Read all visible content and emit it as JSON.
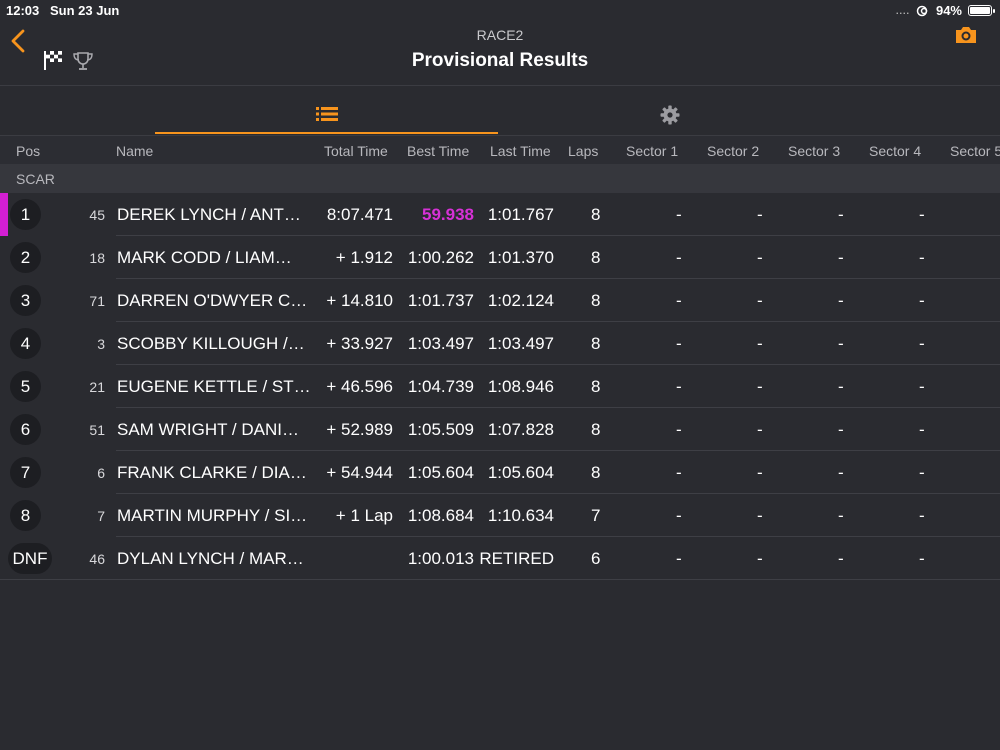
{
  "status_bar": {
    "time": "12:03",
    "date": "Sun 23 Jun",
    "signal": "....",
    "battery": "94%"
  },
  "header": {
    "subtitle": "RACE2",
    "title": "Provisional Results"
  },
  "colors": {
    "accent": "#f7941d",
    "fastest_lap": "#d631d6"
  },
  "columns": {
    "pos": "Pos",
    "name": "Name",
    "total_time": "Total Time",
    "best_time": "Best Time",
    "last_time": "Last Time",
    "laps": "Laps",
    "sector1": "Sector 1",
    "sector2": "Sector 2",
    "sector3": "Sector 3",
    "sector4": "Sector 4",
    "sector5": "Sector 5"
  },
  "class_label": "SCAR",
  "results": [
    {
      "pos": "1",
      "number": "45",
      "name": "DEREK LYNCH / ANT…",
      "total": "8:07.471",
      "best": "59.938",
      "last": "1:01.767",
      "laps": "8",
      "s1": "-",
      "s2": "-",
      "s3": "-",
      "s4": "-"
    },
    {
      "pos": "2",
      "number": "18",
      "name": "MARK CODD / LIAM…",
      "total": "+ 1.912",
      "best": "1:00.262",
      "last": "1:01.370",
      "laps": "8",
      "s1": "-",
      "s2": "-",
      "s3": "-",
      "s4": "-"
    },
    {
      "pos": "3",
      "number": "71",
      "name": "DARREN O'DWYER C…",
      "total": "+ 14.810",
      "best": "1:01.737",
      "last": "1:02.124",
      "laps": "8",
      "s1": "-",
      "s2": "-",
      "s3": "-",
      "s4": "-"
    },
    {
      "pos": "4",
      "number": "3",
      "name": "SCOBBY KILLOUGH /…",
      "total": "+ 33.927",
      "best": "1:03.497",
      "last": "1:03.497",
      "laps": "8",
      "s1": "-",
      "s2": "-",
      "s3": "-",
      "s4": "-"
    },
    {
      "pos": "5",
      "number": "21",
      "name": "EUGENE KETTLE / ST…",
      "total": "+ 46.596",
      "best": "1:04.739",
      "last": "1:08.946",
      "laps": "8",
      "s1": "-",
      "s2": "-",
      "s3": "-",
      "s4": "-"
    },
    {
      "pos": "6",
      "number": "51",
      "name": "SAM WRIGHT / DANI…",
      "total": "+ 52.989",
      "best": "1:05.509",
      "last": "1:07.828",
      "laps": "8",
      "s1": "-",
      "s2": "-",
      "s3": "-",
      "s4": "-"
    },
    {
      "pos": "7",
      "number": "6",
      "name": "FRANK CLARKE / DIA…",
      "total": "+ 54.944",
      "best": "1:05.604",
      "last": "1:05.604",
      "laps": "8",
      "s1": "-",
      "s2": "-",
      "s3": "-",
      "s4": "-"
    },
    {
      "pos": "8",
      "number": "7",
      "name": "MARTIN MURPHY / SI…",
      "total": "+ 1 Lap",
      "best": "1:08.684",
      "last": "1:10.634",
      "laps": "7",
      "s1": "-",
      "s2": "-",
      "s3": "-",
      "s4": "-"
    },
    {
      "pos": "DNF",
      "number": "46",
      "name": "DYLAN LYNCH / MAR…",
      "total": "",
      "best": "1:00.013",
      "last": "RETIRED",
      "laps": "6",
      "s1": "-",
      "s2": "-",
      "s3": "-",
      "s4": "-"
    }
  ]
}
